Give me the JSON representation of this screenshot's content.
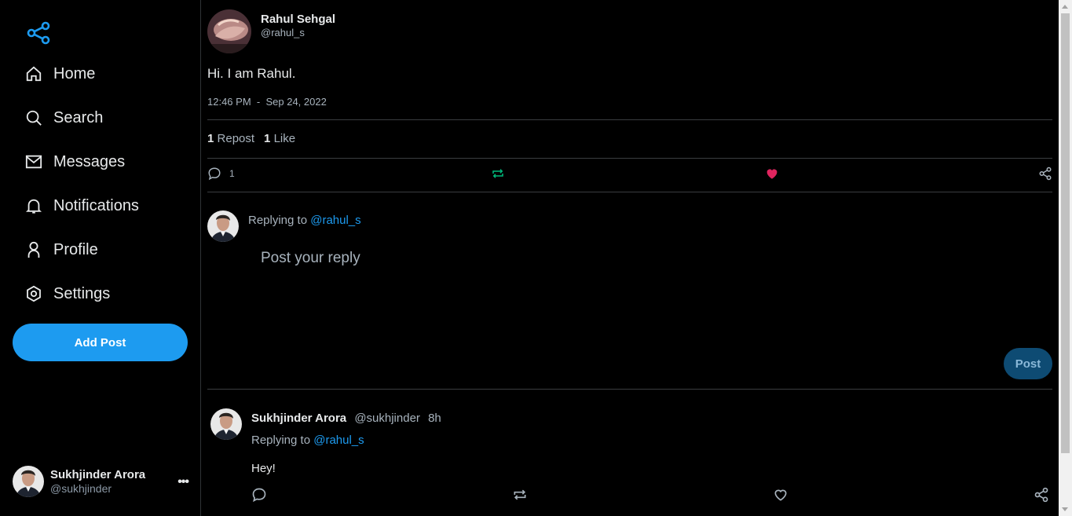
{
  "colors": {
    "accent": "#1d9bf0",
    "like": "#f91880",
    "repost": "#00ba7c",
    "background": "#000000"
  },
  "sidebar": {
    "logo_icon": "share-nodes-icon",
    "items": [
      {
        "label": "Home",
        "icon": "home-icon"
      },
      {
        "label": "Search",
        "icon": "search-icon"
      },
      {
        "label": "Messages",
        "icon": "envelope-icon"
      },
      {
        "label": "Notifications",
        "icon": "bell-icon"
      },
      {
        "label": "Profile",
        "icon": "user-icon"
      },
      {
        "label": "Settings",
        "icon": "settings-icon"
      }
    ],
    "add_post_label": "Add Post",
    "account": {
      "name": "Sukhjinder Arora",
      "handle": "@sukhjinder",
      "more": "•••"
    }
  },
  "post": {
    "author_name": "Rahul Sehgal",
    "author_handle": "@rahul_s",
    "text": "Hi. I am Rahul.",
    "time": "12:46 PM",
    "separator": "-",
    "date": "Sep 24, 2022",
    "repost_count": "1",
    "repost_label": "Repost",
    "like_count": "1",
    "like_label": "Like",
    "comment_count": "1"
  },
  "reply": {
    "replying_prefix": "Replying to",
    "replying_handle": "@rahul_s",
    "placeholder": "Post your reply",
    "post_label": "Post"
  },
  "comments": [
    {
      "name": "Sukhjinder Arora",
      "handle": "@sukhjinder",
      "time": "8h",
      "replying_prefix": "Replying to",
      "replying_handle": "@rahul_s",
      "text": "Hey!"
    }
  ]
}
